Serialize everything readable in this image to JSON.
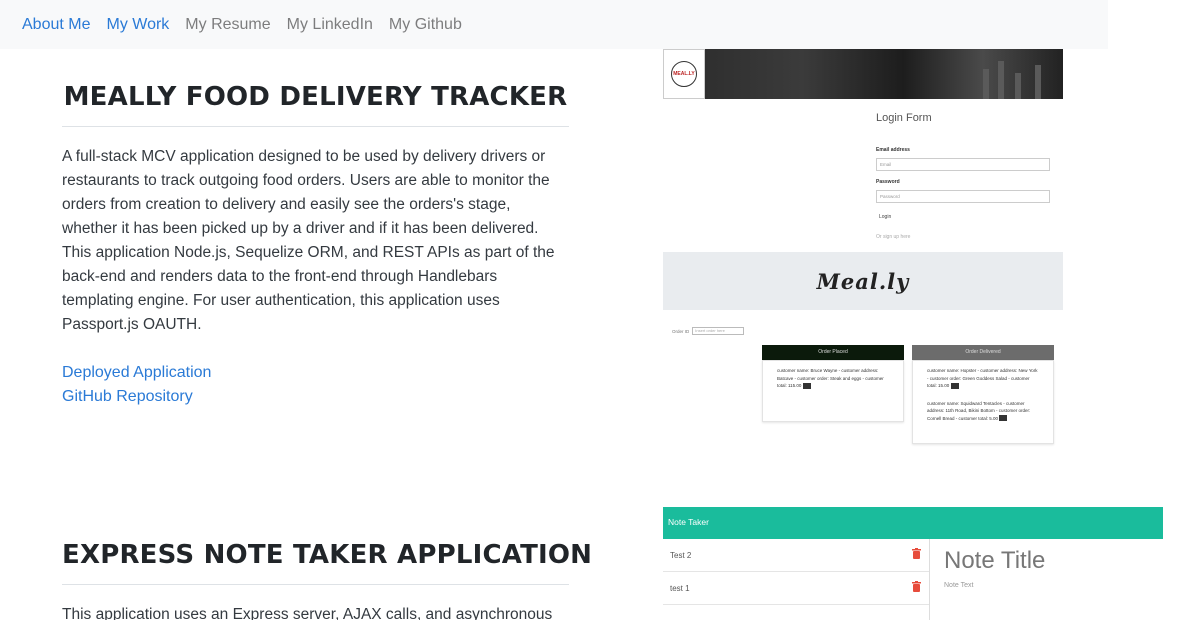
{
  "nav": {
    "items": [
      {
        "label": "About Me",
        "active": true
      },
      {
        "label": "My Work",
        "active": true
      },
      {
        "label": "My Resume",
        "active": false
      },
      {
        "label": "My LinkedIn",
        "active": false
      },
      {
        "label": "My Github",
        "active": false
      }
    ]
  },
  "projects": [
    {
      "title": "MEALLY FOOD DELIVERY TRACKER",
      "description": "A full-stack MCV application designed to be used by delivery drivers or restaurants to track outgoing food orders. Users are able to monitor the orders from creation to delivery and easily see the orders's stage, whether it has been picked up by a driver and if it has been delivered. This application Node.js, Sequelize ORM, and REST APIs as part of the back-end and renders data to the front-end through Handlebars templating engine. For user authentication, this application uses Passport.js OAUTH.",
      "links": [
        "Deployed Application",
        "GitHub Repository"
      ]
    },
    {
      "title": "EXPRESS NOTE TAKER APPLICATION",
      "description": "This application uses an Express server, AJAX calls, and asynchronous"
    }
  ],
  "mealy_screenshot": {
    "logo_text": "MEAL.LY",
    "form_title": "Login Form",
    "email_label": "Email address",
    "email_placeholder": "Email",
    "password_label": "Password",
    "password_placeholder": "Password",
    "login_label": "Login",
    "signup_label": "Or sign up here",
    "brand": "Meal.ly",
    "order_id_label": "Order ID",
    "order_id_placeholder": "Insert order here",
    "col1_header": "Order Placed",
    "col2_header": "Order Delivered",
    "col1_card": "customer name: Bruce Wayne - customer address: Batcave - customer order: Steak and eggs - customer total: 115.00",
    "col2_card1": "customer name: Hopster - customer address: New York - customer order: Green Goddess Salad - customer total: 15.00",
    "col2_card2": "customer name: Squidward Tentacles - customer address: 11th Road, Bikini Bottom - customer order: Cornell Bread - customer total: 5.00",
    "colors": {
      "col1": "#0b1a0b",
      "col2": "#6c6c6c"
    }
  },
  "note_screenshot": {
    "app_title": "Note Taker",
    "notes": [
      "Test 2",
      "test 1"
    ],
    "note_title_placeholder": "Note Title",
    "note_text_placeholder": "Note Text",
    "colors": {
      "bar": "#1abc9c",
      "trash": "#e74c3c"
    }
  }
}
